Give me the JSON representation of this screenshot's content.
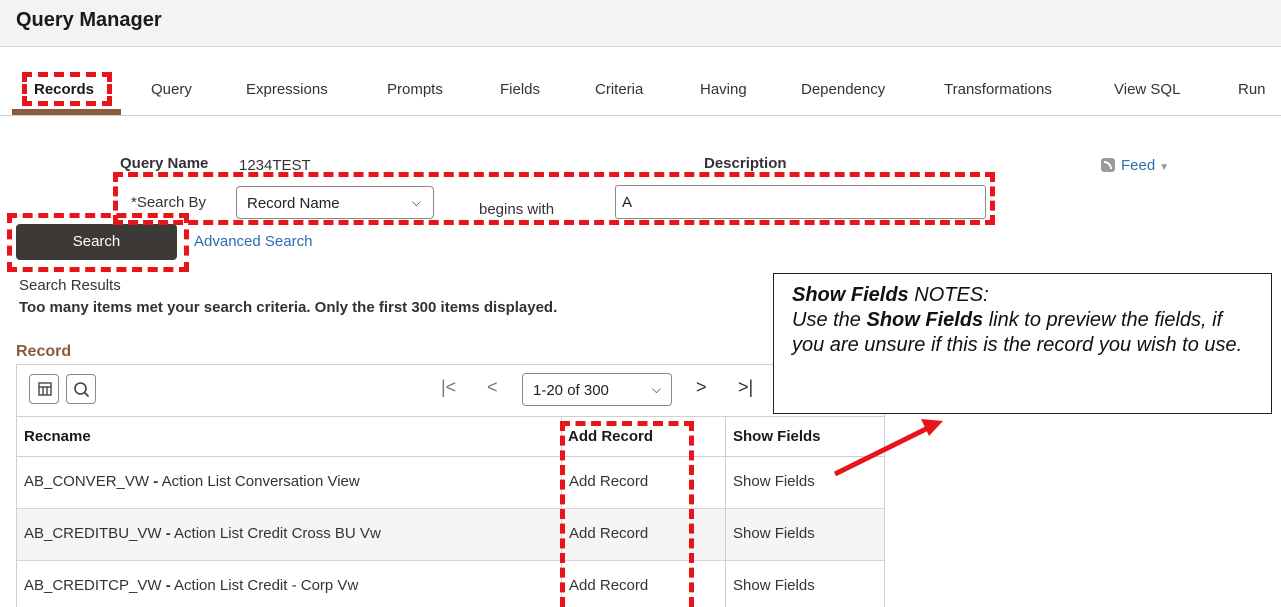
{
  "page_title": "Query Manager",
  "tabs": [
    {
      "label": "Records",
      "active": true
    },
    {
      "label": "Query"
    },
    {
      "label": "Expressions"
    },
    {
      "label": "Prompts"
    },
    {
      "label": "Fields"
    },
    {
      "label": "Criteria"
    },
    {
      "label": "Having"
    },
    {
      "label": "Dependency"
    },
    {
      "label": "Transformations"
    },
    {
      "label": "View SQL"
    },
    {
      "label": "Run"
    }
  ],
  "query": {
    "name_label": "Query Name",
    "name_value": "1234TEST",
    "description_label": "Description"
  },
  "feed": {
    "label": "Feed",
    "icon": "rss-feed-icon"
  },
  "search": {
    "search_by_label": "*Search By",
    "search_by_value": "Record Name",
    "operator_label": "begins with",
    "search_value": "A",
    "search_button": "Search",
    "advanced_link": "Advanced Search"
  },
  "results": {
    "heading": "Search Results",
    "message": "Too many items met your search criteria. Only the first 300 items displayed."
  },
  "grid": {
    "title": "Record",
    "pager": "1-20 of 300",
    "columns": [
      "Recname",
      "Add Record",
      "Show Fields"
    ],
    "rows": [
      {
        "recname": "AB_CONVER_VW",
        "desc": "Action List Conversation View",
        "add": "Add Record",
        "show": "Show Fields"
      },
      {
        "recname": "AB_CREDITBU_VW",
        "desc": "Action List Credit Cross BU Vw",
        "add": "Add Record",
        "show": "Show Fields"
      },
      {
        "recname": "AB_CREDITCP_VW",
        "desc": "Action List Credit - Corp Vw",
        "add": "Add Record",
        "show": "Show Fields"
      }
    ]
  },
  "note": {
    "title_bold": "Show Fields",
    "title_rest": " NOTES:",
    "line_pre": "Use the ",
    "line_bold": "Show Fields",
    "line_post": " link to preview the fields, if you are unsure if this is the record you wish to use."
  },
  "colors": {
    "highlight": "#e8141a",
    "accent": "#8b5a3c",
    "link": "#2a6db4",
    "button": "#3d3937"
  }
}
